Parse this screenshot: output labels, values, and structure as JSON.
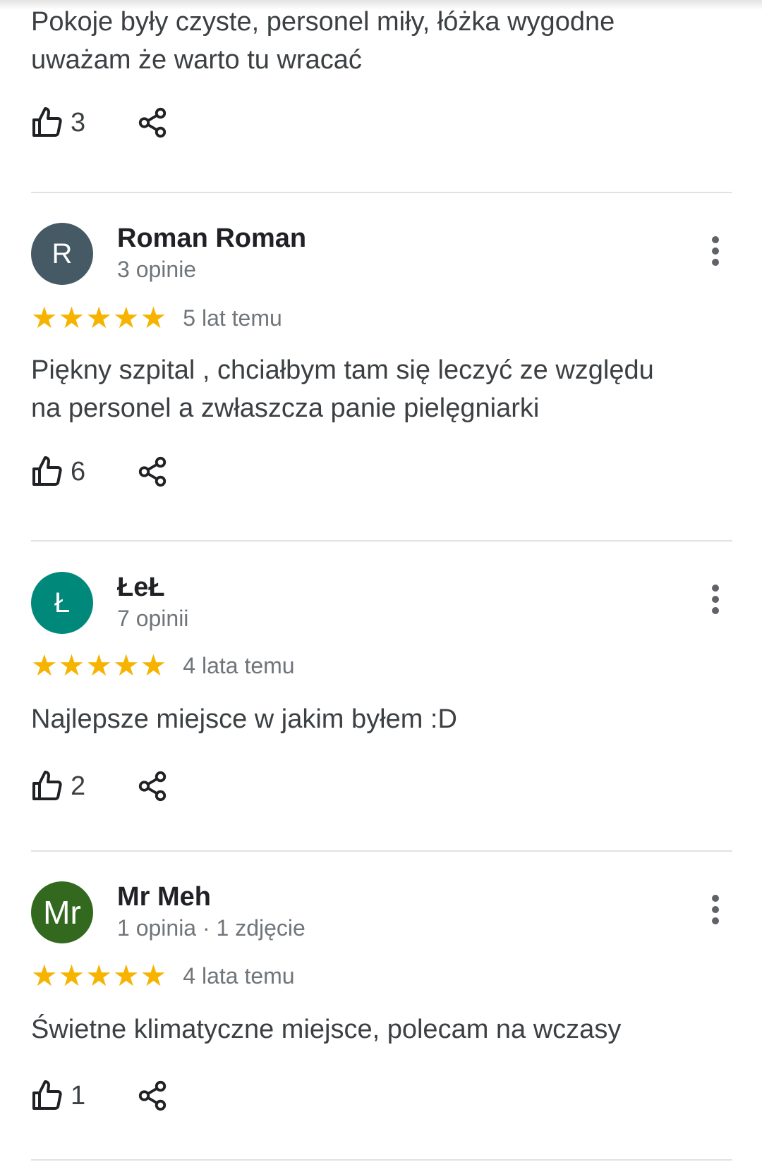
{
  "partial_review": {
    "text": "Pokoje były czyste, personel miły, łóżka wygodne\nuważam że warto tu wracać",
    "likes": "3"
  },
  "reviews": [
    {
      "avatar_letter": "R",
      "avatar_color": "#455a64",
      "name": "Roman Roman",
      "meta": "3 opinie",
      "stars": 5,
      "date": "5 lat temu",
      "text": "Piękny szpital , chciałbym tam się leczyć ze względu\nna personel a zwłaszcza panie pielęgniarki",
      "likes": "6"
    },
    {
      "avatar_letter": "Ł",
      "avatar_color": "#00897b",
      "name": "ŁeŁ",
      "meta": "7 opinii",
      "stars": 5,
      "date": "4 lata temu",
      "text": "Najlepsze miejsce w jakim byłem :D",
      "likes": "2"
    },
    {
      "avatar_letter": "Mr",
      "avatar_color": "#33691e",
      "name": "Mr Meh",
      "meta": "1 opinia · 1 zdjęcie",
      "stars": 5,
      "date": "4 lata temu",
      "text": "Świetne klimatyczne miejsce, polecam na wczasy",
      "likes": "1"
    }
  ],
  "colors": {
    "star": "#f6b400",
    "text": "#3c4043",
    "meta": "#70757a",
    "divider": "#e2e2e2"
  },
  "icons": {
    "like": "thumbs-up-icon",
    "share": "share-icon",
    "more": "more-vert-icon",
    "star": "star-icon"
  }
}
